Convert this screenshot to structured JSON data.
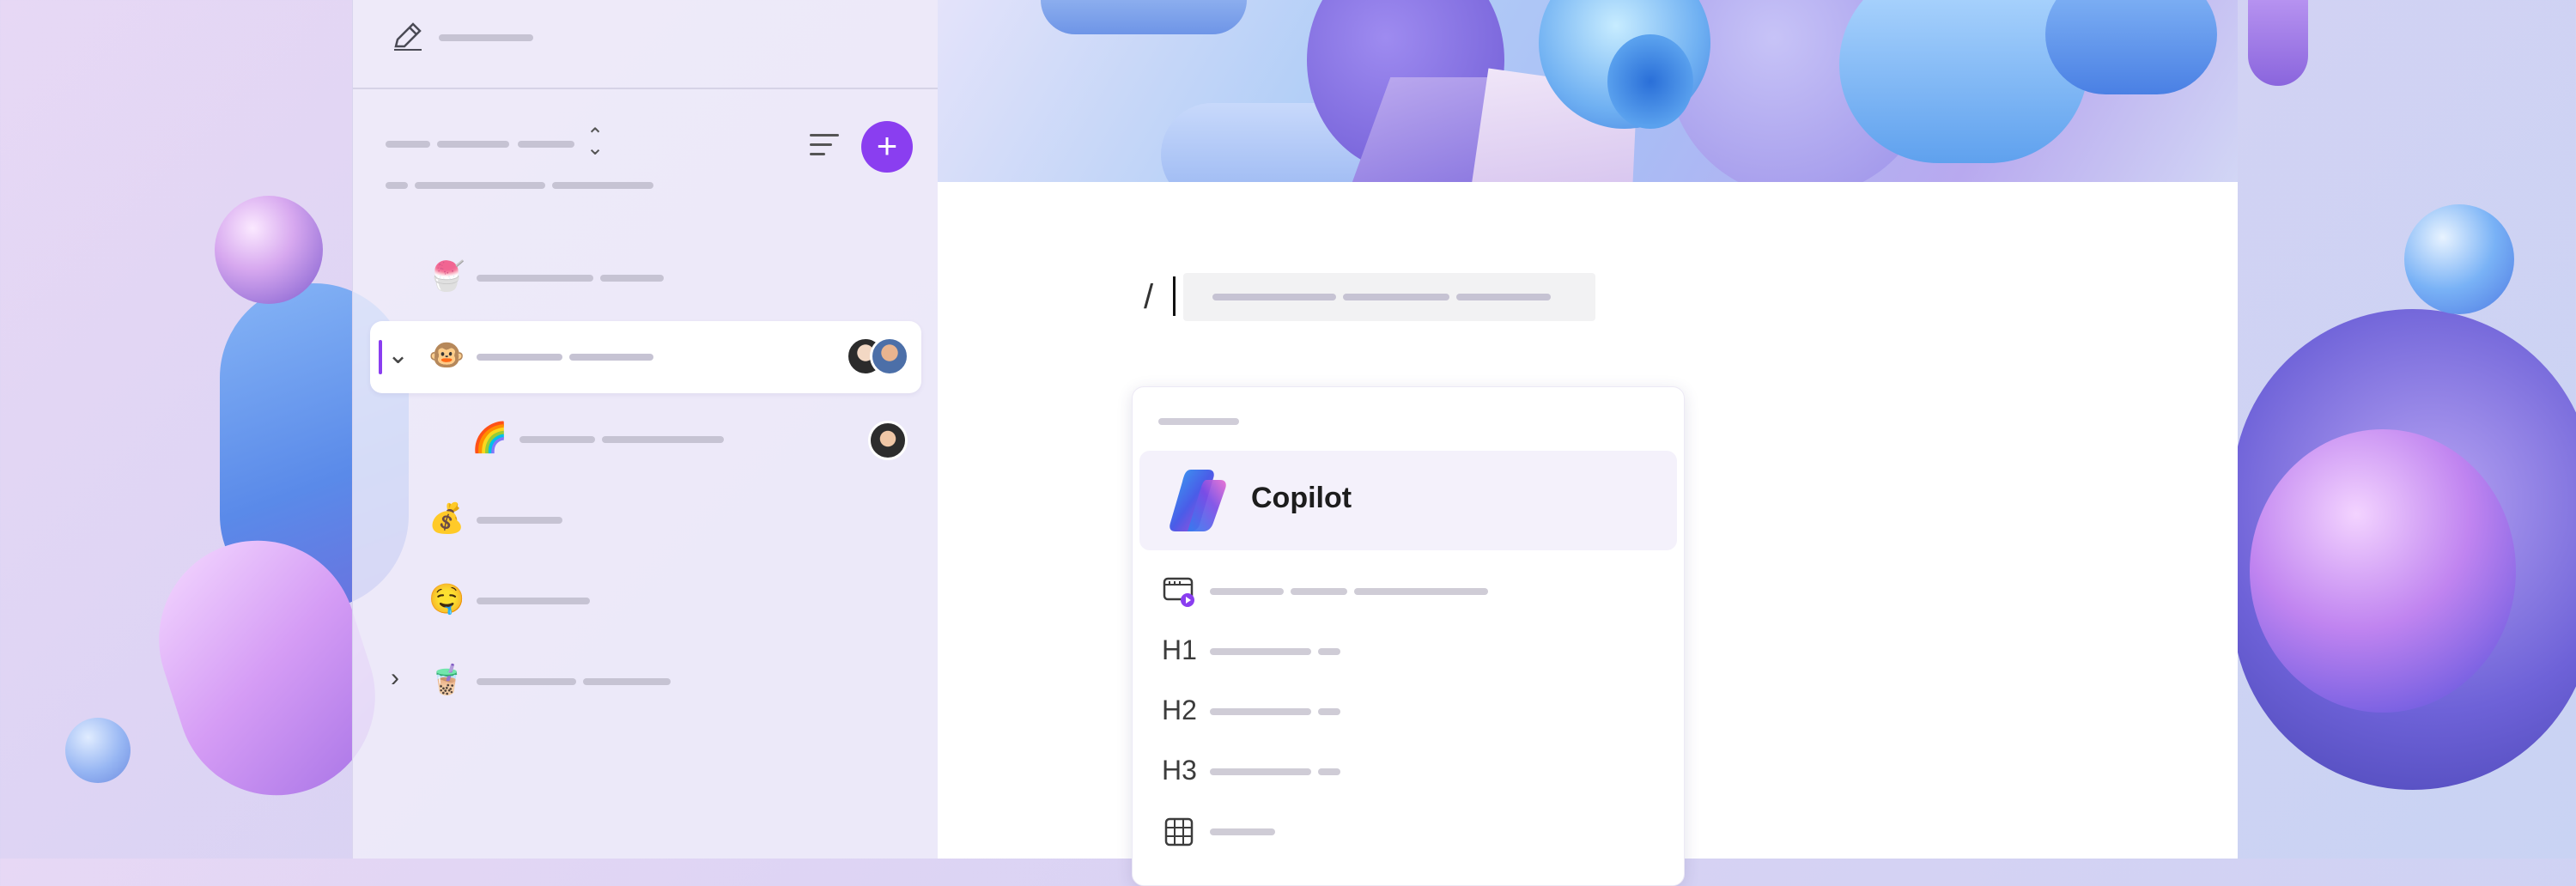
{
  "window": {
    "title": ""
  },
  "sidebar": {
    "compose_icon": "pen-icon",
    "add_button_label": "+",
    "items": [
      {
        "emoji": "🍧",
        "expanded": null,
        "selected": false
      },
      {
        "emoji": "🐵",
        "expanded": true,
        "selected": true
      },
      {
        "emoji": "🌈",
        "expanded": null,
        "selected": false
      },
      {
        "emoji": "💰",
        "expanded": null,
        "selected": false
      },
      {
        "emoji": "🤤",
        "expanded": null,
        "selected": false
      },
      {
        "emoji": "🧋",
        "expanded": false,
        "selected": false
      }
    ]
  },
  "editor": {
    "slash_command": "/",
    "menu": {
      "items": [
        {
          "label": "Copilot",
          "icon": "copilot-logo-icon",
          "highlighted": true
        },
        {
          "label": "",
          "icon": "video-icon"
        },
        {
          "label": "H1",
          "icon": ""
        },
        {
          "label": "H2",
          "icon": ""
        },
        {
          "label": "H3",
          "icon": ""
        },
        {
          "label": "",
          "icon": "table-icon"
        }
      ]
    }
  },
  "colors": {
    "accent": "#8a3ef0"
  }
}
